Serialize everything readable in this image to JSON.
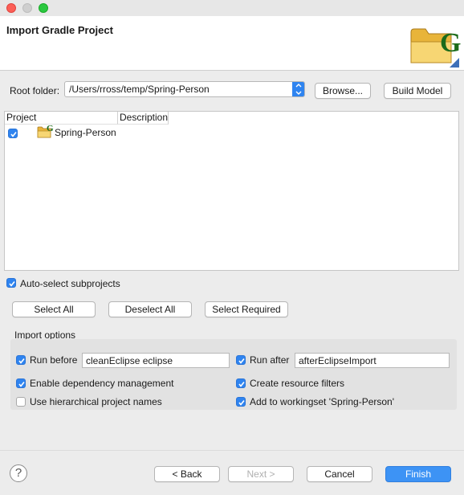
{
  "dialog": {
    "title": "Import Gradle Project"
  },
  "root": {
    "label": "Root folder:",
    "path": "/Users/rross/temp/Spring-Person",
    "browse": "Browse...",
    "build_model": "Build Model"
  },
  "table": {
    "col_project": "Project",
    "col_description": "Description",
    "rows": [
      {
        "name": "Spring-Person",
        "checked": true
      }
    ]
  },
  "auto_select": {
    "label": "Auto-select subprojects",
    "checked": true
  },
  "selection_buttons": {
    "select_all": "Select All",
    "deselect_all": "Deselect All",
    "select_required": "Select Required"
  },
  "import_options": {
    "heading": "Import options",
    "run_before": {
      "label": "Run before",
      "checked": true,
      "value": "cleanEclipse eclipse"
    },
    "run_after": {
      "label": "Run after",
      "checked": true,
      "value": "afterEclipseImport"
    },
    "dependency_mgmt": {
      "label": "Enable dependency management",
      "checked": true
    },
    "resource_filters": {
      "label": "Create resource filters",
      "checked": true
    },
    "hierarchical_names": {
      "label": "Use hierarchical project names",
      "checked": false
    },
    "workingset": {
      "label": "Add to workingset 'Spring-Person'",
      "checked": true
    }
  },
  "footer": {
    "help": "?",
    "back": "< Back",
    "next": "Next >",
    "cancel": "Cancel",
    "finish": "Finish"
  },
  "colors": {
    "accent": "#2f84f0",
    "gradle_green": "#1b6b1b",
    "folder_yellow": "#f2c955"
  },
  "icons": {
    "header": "gradle-folder-icon",
    "row": "gradle-project-icon"
  }
}
